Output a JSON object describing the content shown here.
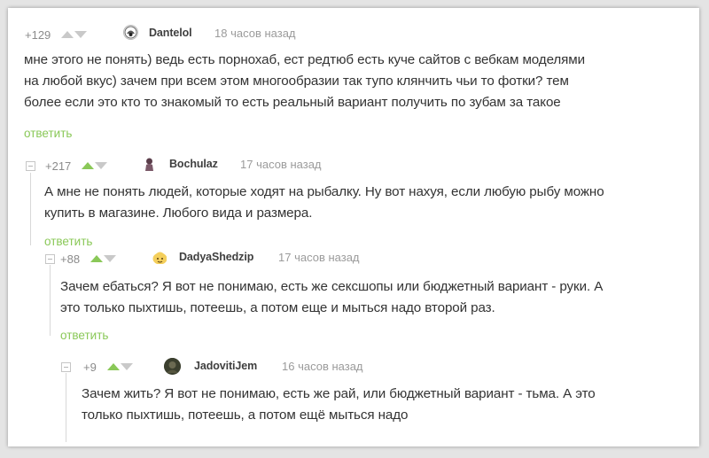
{
  "comments": [
    {
      "rating": "+129",
      "username": "Dantelol",
      "time": "18 часов назад",
      "lines": [
        "мне этого не понять) ведь есть порнохаб, ест редтюб есть куче сайтов с вебкам моделями",
        "на любой вкус) зачем при всем этом многообразии так тупо клянчить чьи то фотки? тем",
        "более  если   это кто то знакомый то есть реальный вариант получить по зубам за такое"
      ],
      "reply": "ответить"
    },
    {
      "rating": "+217",
      "username": "Bochulaz",
      "time": "17 часов назад",
      "lines": [
        "А мне не понять людей, которые ходят на рыбалку. Ну вот нахуя, если любую рыбу можно",
        "купить в магазине. Любого вида и размера."
      ],
      "reply": "ответить"
    },
    {
      "rating": "+88",
      "username": "DadyaShedzip",
      "time": "17 часов назад",
      "lines": [
        "Зачем ебаться? Я вот не понимаю, есть же сексшопы или бюджетный вариант - руки. А",
        "это только пыхтишь, потеешь, а потом еще и мыться надо второй раз."
      ],
      "reply": "ответить"
    },
    {
      "rating": "+9",
      "username": "JadovitiJem",
      "time": "16 часов назад",
      "lines": [
        "Зачем жить? Я вот не понимаю, есть же рай, или бюджетный вариант - тьма. А это",
        "только пыхтишь, потеешь, а потом ещё мыться надо"
      ]
    }
  ],
  "colors": {
    "accent_green": "#8ac858",
    "text": "#333333",
    "meta_grey": "#8b8b8b"
  }
}
